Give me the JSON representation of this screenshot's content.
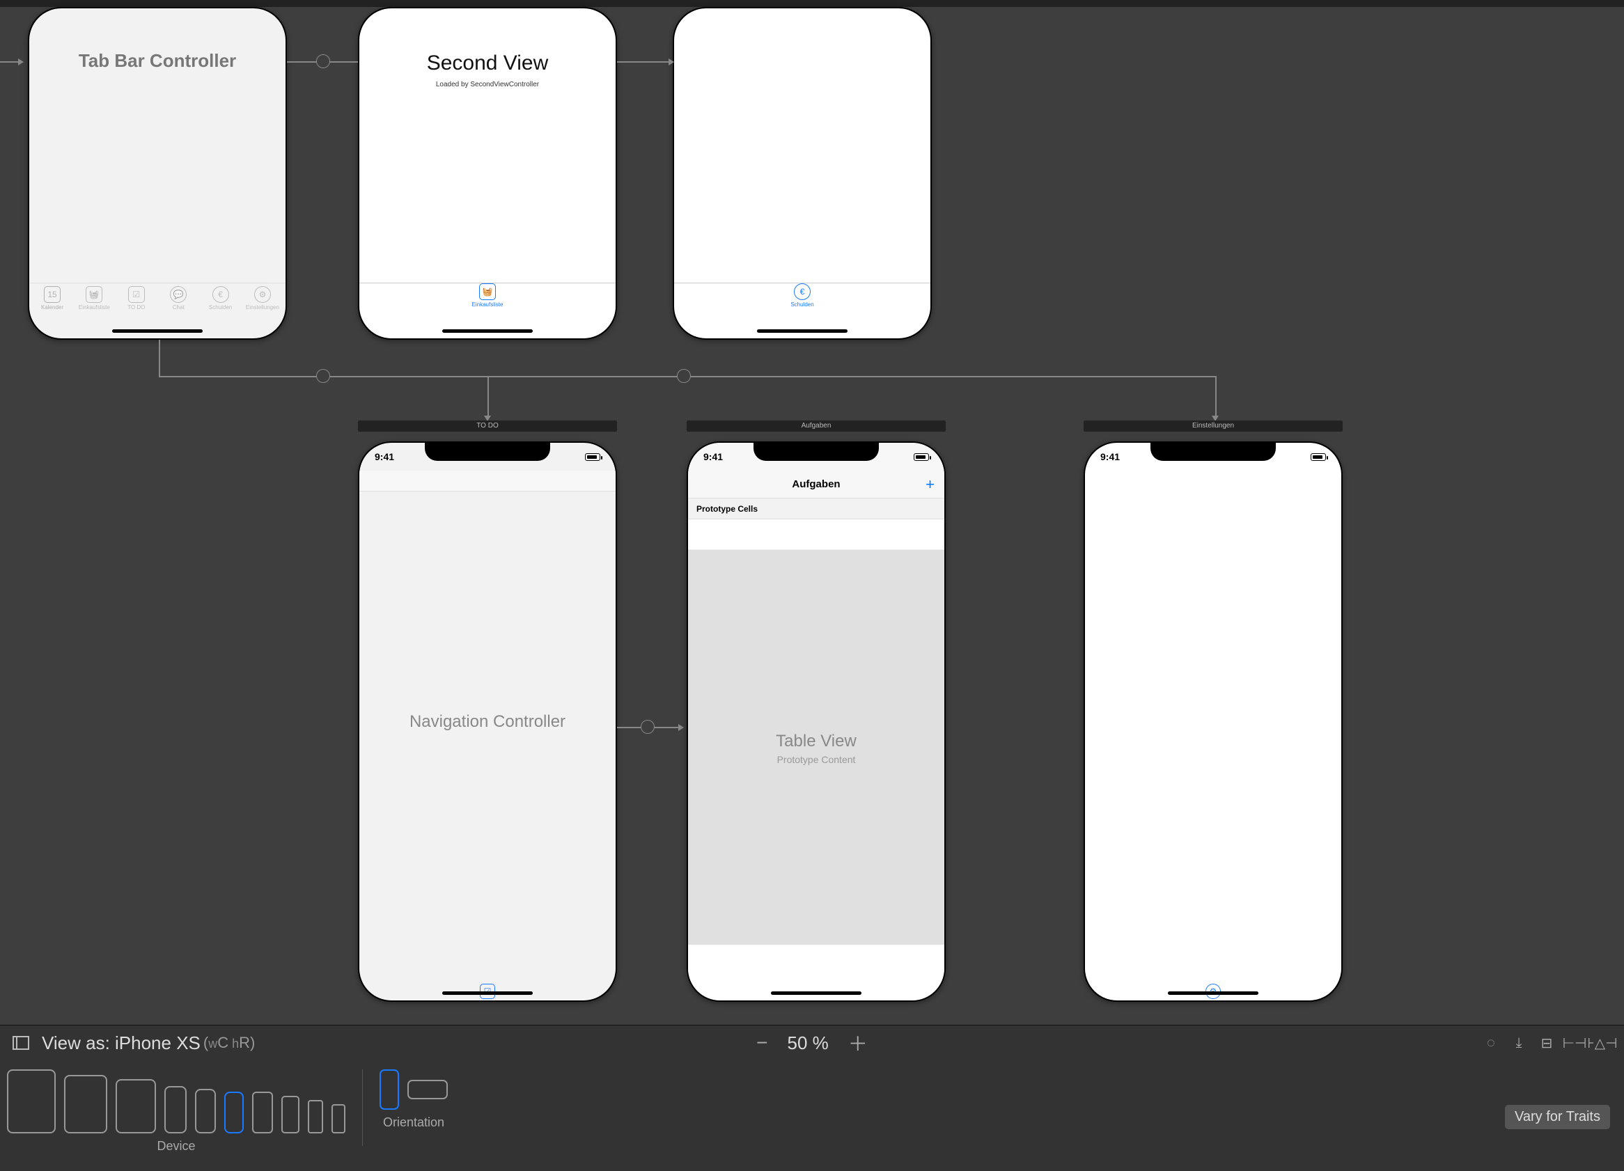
{
  "topRow": {
    "tabBarController": {
      "title": "Tab Bar Controller",
      "tabs": [
        {
          "label": "Kalender",
          "icon": "calendar",
          "active": true
        },
        {
          "label": "Einkaufsliste",
          "icon": "basket",
          "active": false
        },
        {
          "label": "TO DO",
          "icon": "clipboard",
          "active": false
        },
        {
          "label": "Chat",
          "icon": "chat",
          "active": false
        },
        {
          "label": "Schulden",
          "icon": "euro",
          "active": false
        },
        {
          "label": "Einstellungen",
          "icon": "gear",
          "active": false
        }
      ]
    },
    "secondView": {
      "title": "Second View",
      "subtitle": "Loaded by SecondViewController",
      "tab": {
        "label": "Einkaufsliste",
        "icon": "basket"
      }
    },
    "schuldenView": {
      "tab": {
        "label": "Schulden",
        "icon": "euro"
      }
    }
  },
  "bottomRow": {
    "todo": {
      "sceneTitle": "TO DO",
      "statusTime": "9:41",
      "placeholder": "Navigation Controller",
      "tabIcon": "clipboard"
    },
    "aufgaben": {
      "sceneTitle": "Aufgaben",
      "statusTime": "9:41",
      "navTitle": "Aufgaben",
      "addLabel": "+",
      "prototypeHeader": "Prototype Cells",
      "tvTitle": "Table View",
      "tvSubtitle": "Prototype Content"
    },
    "einstellungen": {
      "sceneTitle": "Einstellungen",
      "statusTime": "9:41",
      "tabIcon": "gear"
    }
  },
  "footer": {
    "viewAsLabel": "View as: iPhone XS",
    "sizeW": "w",
    "sizeC": "C",
    "sizeH": " h",
    "sizeR": "R",
    "sizeOpen": " (",
    "sizeClose": ")",
    "zoomLevel": "50 %",
    "deviceLabel": "Device",
    "orientationLabel": "Orientation",
    "varyLabel": "Vary for Traits"
  }
}
